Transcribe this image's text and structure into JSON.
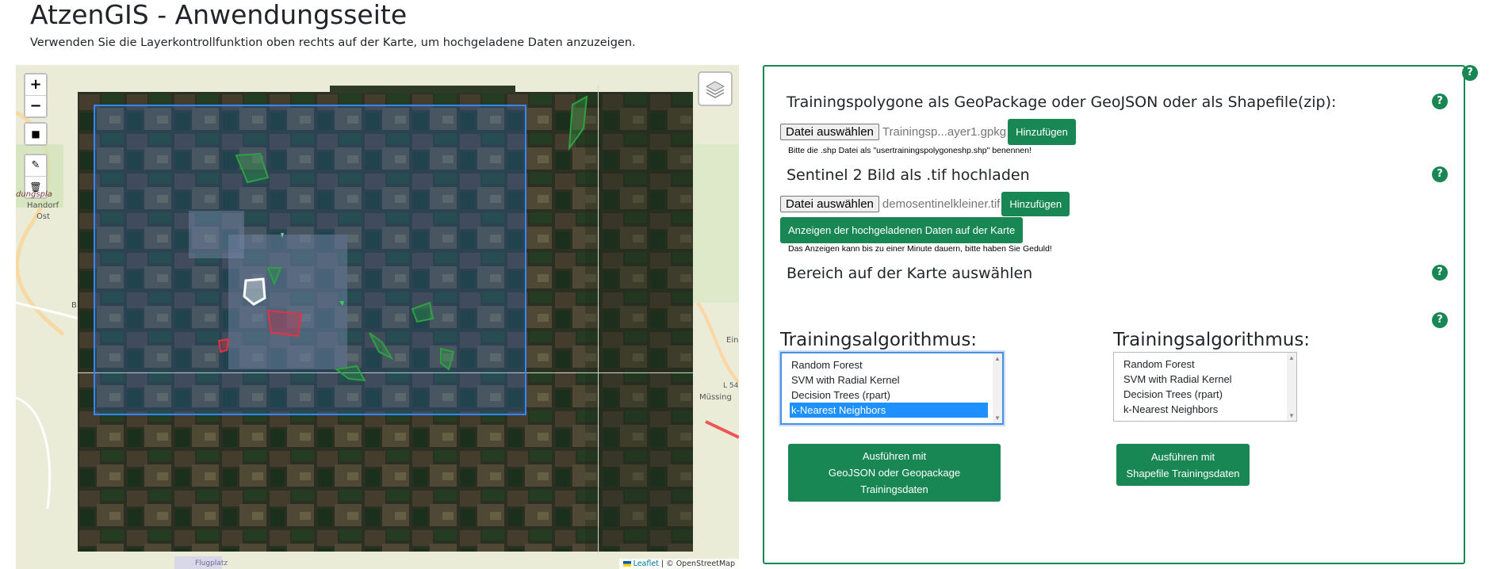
{
  "page": {
    "title": "AtzenGIS - Anwendungsseite",
    "subtitle": "Verwenden Sie die Layerkontrollfunktion oben rechts auf der Karte, um hochgeladene Daten anzuzeigen."
  },
  "map": {
    "zoom_in": "+",
    "zoom_out": "−",
    "draw_rect_icon": "■",
    "edit_icon": "✎",
    "delete_icon": "🗑",
    "layers_icon": "layers-icon",
    "place_labels": [
      "dungspla",
      "Handorf",
      "Ost",
      "B",
      "Ein",
      "L 54",
      "Müssing",
      "Flugplatz"
    ],
    "attribution_leaflet": "Leaflet",
    "attribution_rest": " | © OpenStreetMap"
  },
  "panel": {
    "help_top": "?",
    "section1": {
      "title": "Trainingspolygone als GeoPackage oder GeoJSON oder als Shapefile(zip):",
      "file_button": "Datei auswählen",
      "file_name": "Trainingsp...ayer1.gpkg",
      "add_button": "Hinzufügen",
      "note": "Bitte die .shp Datei als \"usertrainingspolygoneshp.shp\" benennen!",
      "help": "?"
    },
    "section2": {
      "title": "Sentinel 2 Bild als .tif hochladen",
      "file_button": "Datei auswählen",
      "file_name": "demosentinelkleiner.tif",
      "add_button": "Hinzufügen",
      "show_button": "Anzeigen der hochgeladenen Daten auf der Karte",
      "note": "Das Anzeigen kann bis zu einer Minute dauern, bitte haben Sie Geduld!",
      "help": "?"
    },
    "section3": {
      "title": "Bereich auf der Karte auswählen",
      "help": "?"
    },
    "help4": "?",
    "algo_left": {
      "label": "Trainingsalgorithmus:",
      "options": [
        "Random Forest",
        "SVM with Radial Kernel",
        "Decision Trees (rpart)",
        "k-Nearest Neighbors"
      ],
      "selected": "k-Nearest Neighbors",
      "run_button": [
        "Ausführen mit",
        "GeoJSON oder Geopackage",
        "Trainingsdaten"
      ]
    },
    "algo_right": {
      "label": "Trainingsalgorithmus:",
      "options": [
        "Random Forest",
        "SVM with Radial Kernel",
        "Decision Trees (rpart)",
        "k-Nearest Neighbors"
      ],
      "run_button": [
        "Ausführen mit",
        "Shapefile Trainingsdaten"
      ]
    }
  },
  "colors": {
    "accent": "#198754",
    "selection": "#1e90ff",
    "aoi_rect": "#3388ff"
  }
}
